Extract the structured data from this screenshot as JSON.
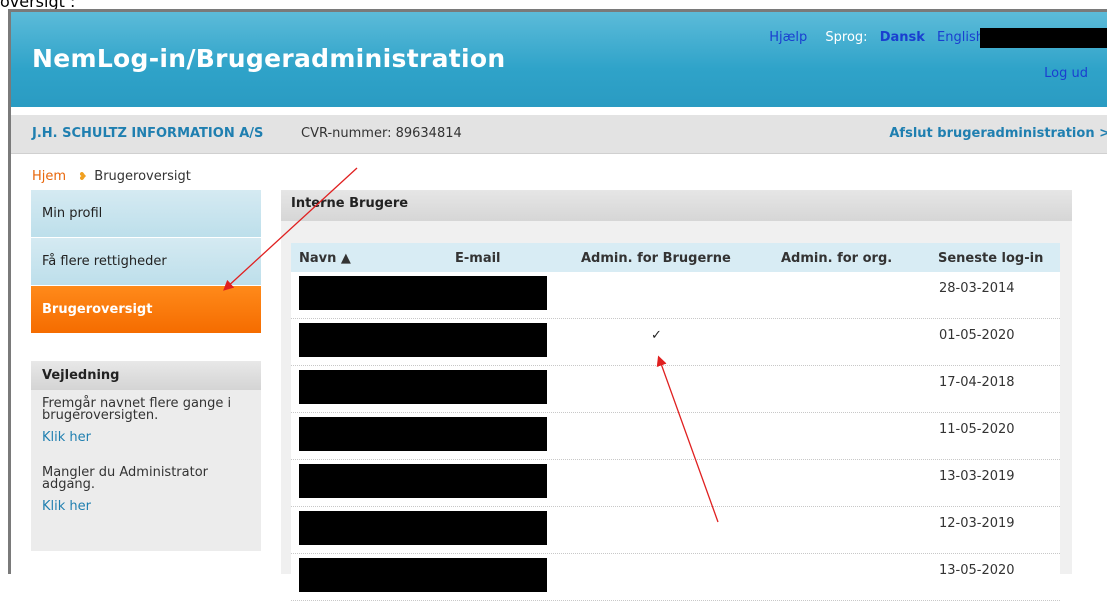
{
  "top_cut_text": "oversigt :",
  "header": {
    "title": "NemLog-in/Brugeradministration",
    "help_link": "Hjælp",
    "language_label": "Sprog:",
    "lang_dansk": "Dansk",
    "lang_english": "English",
    "logout": "Log ud"
  },
  "org": {
    "name": "J.H. SCHULTZ INFORMATION A/S",
    "cvr": "CVR-nummer: 89634814",
    "exit": "Afslut brugeradministration >"
  },
  "breadcrumb": {
    "home": "Hjem",
    "current": "Brugeroversigt"
  },
  "sidebar": {
    "items": [
      {
        "label": "Min profil"
      },
      {
        "label": "Få flere rettigheder"
      },
      {
        "label": "Brugeroversigt"
      }
    ]
  },
  "help": {
    "title": "Vejledning",
    "text1": "Fremgår navnet flere gange i brugeroversigten.",
    "link1": "Klik her",
    "text2": "Mangler du Administrator adgang.",
    "link2": "Klik her"
  },
  "panel": {
    "title": "Interne Brugere",
    "columns": [
      "Navn ▲",
      "E-mail",
      "Admin. for Brugerne",
      "Admin. for org.",
      "Seneste log-in"
    ],
    "rows": [
      {
        "admin_users": "",
        "last_login": "28-03-2014"
      },
      {
        "admin_users": "✓",
        "last_login": "01-05-2020"
      },
      {
        "admin_users": "",
        "last_login": "17-04-2018"
      },
      {
        "admin_users": "",
        "last_login": "11-05-2020"
      },
      {
        "admin_users": "",
        "last_login": "13-03-2019"
      },
      {
        "admin_users": "",
        "last_login": "12-03-2019"
      },
      {
        "admin_users": "",
        "last_login": "13-05-2020"
      }
    ]
  },
  "colors": {
    "header_blue": "#2fa3c9",
    "active_orange": "#f56c00",
    "link_blue": "#1f7fb0",
    "annotation_red": "#e02020"
  }
}
